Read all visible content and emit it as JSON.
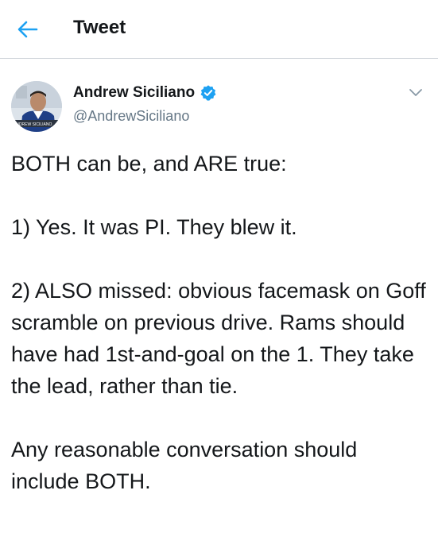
{
  "header": {
    "title": "Tweet",
    "back_icon": "arrow-left-icon"
  },
  "author": {
    "display_name": "Andrew Siciliano",
    "handle": "@AndrewSiciliano",
    "verified_icon": "verified-badge-icon",
    "avatar_caption": "ANDREW SICILIANO",
    "menu_icon": "chevron-down-icon"
  },
  "tweet": {
    "paragraphs": [
      "BOTH can be, and ARE true:",
      "1) Yes. It was PI. They blew it.",
      "2) ALSO missed: obvious facemask on Goff scramble on previous drive. Rams should have had 1st-and-goal on the 1. They take the lead, rather than tie.",
      "Any reasonable conversation should include BOTH."
    ]
  },
  "colors": {
    "accent": "#1da1f2",
    "text": "#14171a",
    "secondary": "#657786",
    "divider": "#cfd4d9"
  }
}
